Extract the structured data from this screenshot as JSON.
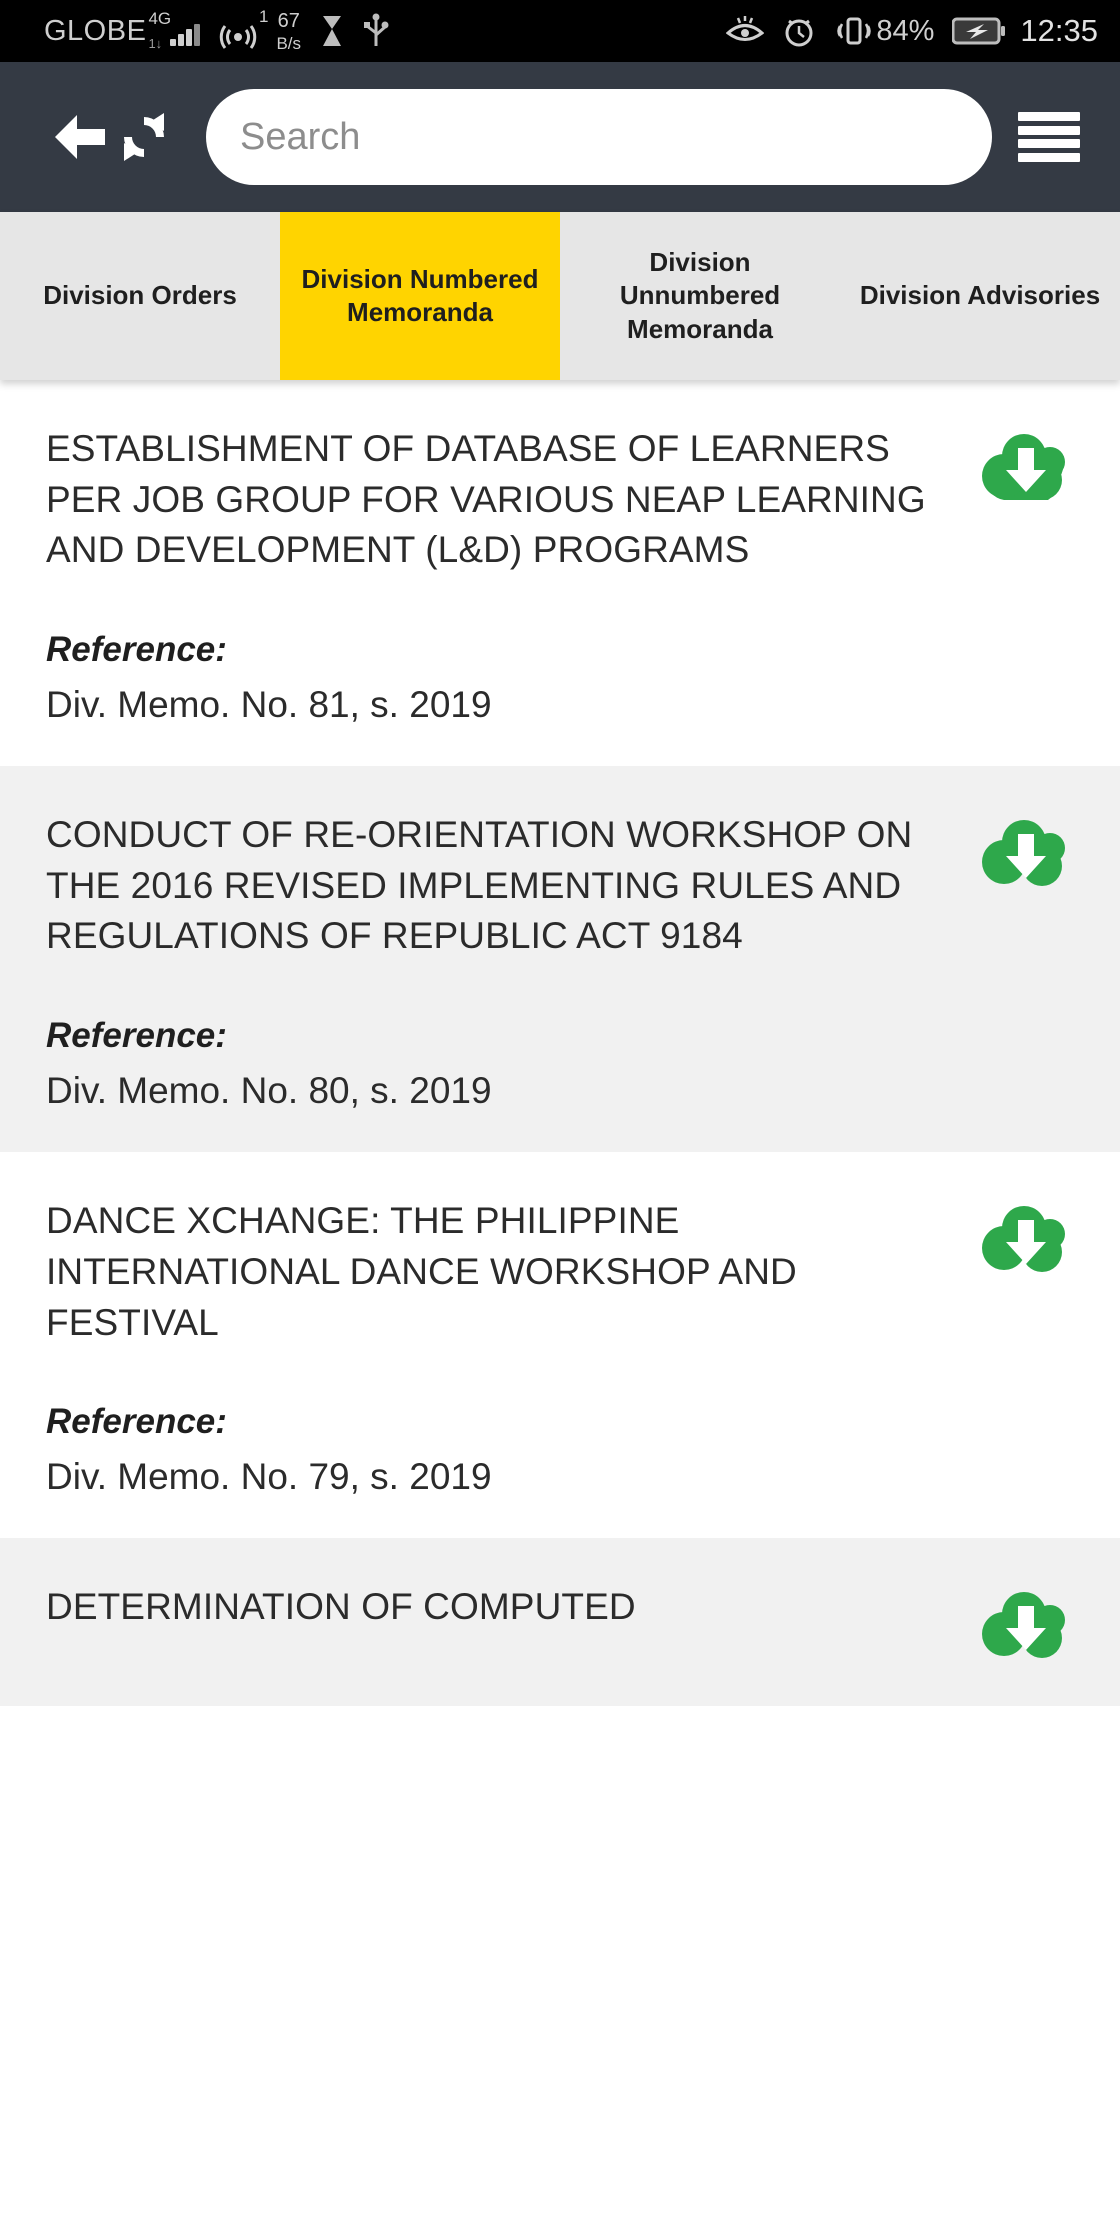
{
  "status_bar": {
    "carrier": "GLOBE",
    "network_type": "4G",
    "network_sub": "1↓",
    "hotspot_count": "1",
    "data_rate_value": "67",
    "data_rate_unit": "B/s",
    "icons": [
      "hourglass-icon",
      "usb-icon",
      "eye-comfort-icon",
      "alarm-clock-icon",
      "vibrate-icon",
      "battery-charging-icon"
    ],
    "battery_percent": "84%",
    "clock": "12:35"
  },
  "toolbar": {
    "back_icon": "back-arrow-icon",
    "refresh_icon": "refresh-icon",
    "menu_icon": "hamburger-menu-icon",
    "search_placeholder": "Search"
  },
  "tabs": [
    {
      "label": "Division Orders",
      "active": false
    },
    {
      "label": "Division Numbered Memoranda",
      "active": true
    },
    {
      "label": "Division Unnumbered Memoranda",
      "active": false
    },
    {
      "label": "Division Advisories",
      "active": false
    }
  ],
  "colors": {
    "status_bar_bg": "#000000",
    "toolbar_bg": "#343a44",
    "tab_bar_bg": "#e6e6e6",
    "tab_active_bg": "#FFD400",
    "row_bg": "#ffffff",
    "row_alt_bg": "#f1f1f1",
    "download_icon_green": "#2EA84B",
    "title_text": "#2b2b2b"
  },
  "list": {
    "reference_label": "Reference:",
    "download_icon": "cloud-download-icon",
    "items": [
      {
        "title": "ESTABLISHMENT OF DATABASE OF LEARNERS PER JOB GROUP FOR VARIOUS NEAP LEARNING AND DEVELOPMENT (L&D) PROGRAMS",
        "reference": "Div. Memo. No. 81, s. 2019"
      },
      {
        "title": "CONDUCT OF RE-ORIENTATION WORKSHOP ON THE 2016 REVISED IMPLEMENTING RULES AND REGULATIONS OF REPUBLIC ACT 9184",
        "reference": "Div. Memo. No. 80, s. 2019"
      },
      {
        "title": "DANCE XCHANGE: THE PHILIPPINE INTERNATIONAL DANCE WORKSHOP AND FESTIVAL",
        "reference": "Div. Memo. No. 79, s. 2019"
      },
      {
        "title": "DETERMINATION OF COMPUTED",
        "reference": ""
      }
    ]
  }
}
